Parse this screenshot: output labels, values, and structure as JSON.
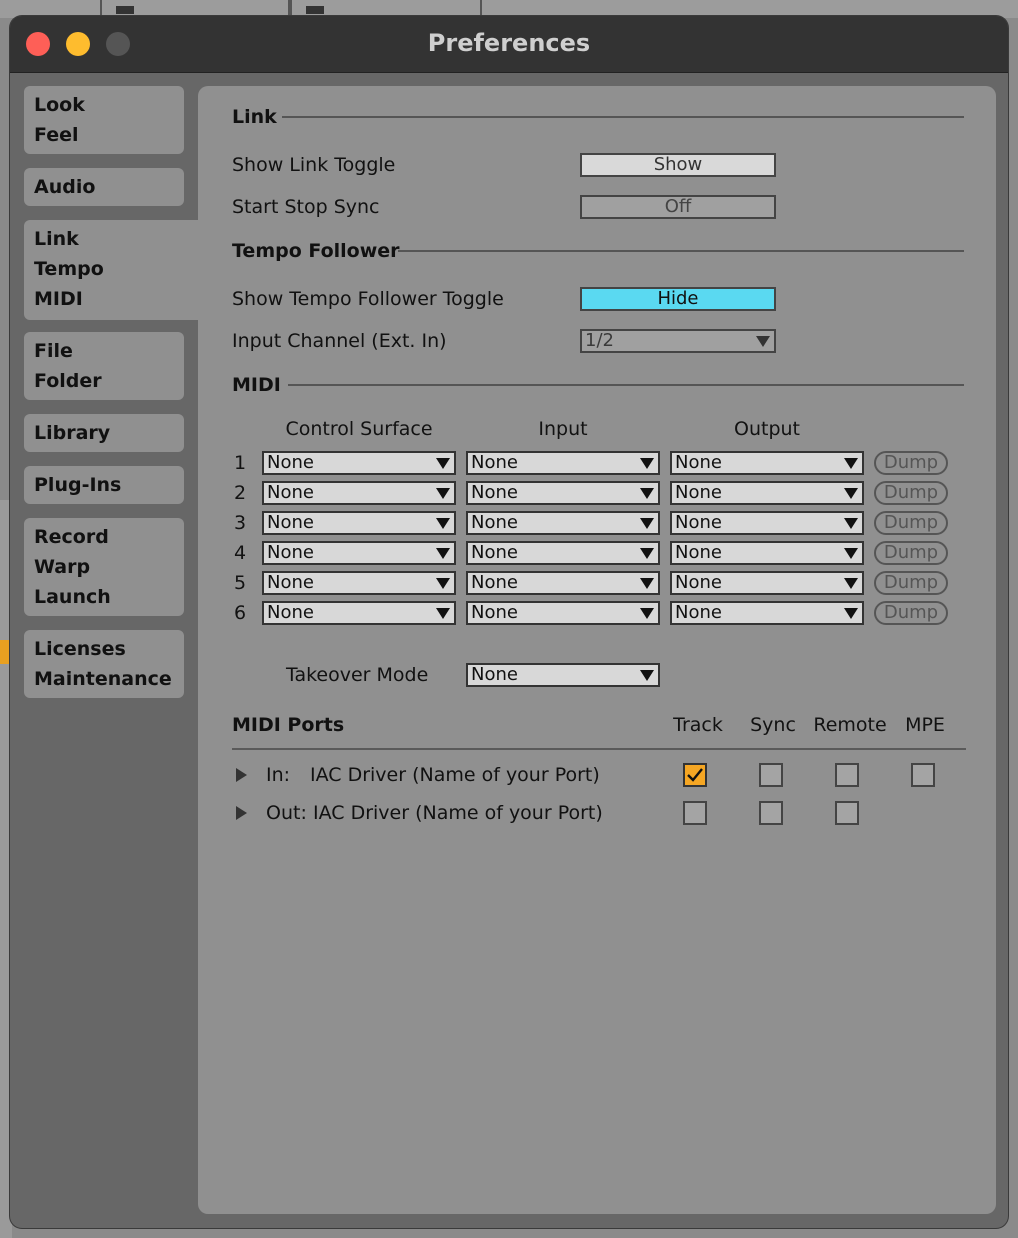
{
  "window": {
    "title": "Preferences"
  },
  "sidebar": {
    "groups": [
      {
        "items": [
          "Look",
          "Feel"
        ]
      },
      {
        "items": [
          "Audio"
        ]
      },
      {
        "items": [
          "Link",
          "Tempo",
          "MIDI"
        ]
      },
      {
        "items": [
          "File",
          "Folder"
        ]
      },
      {
        "items": [
          "Library"
        ]
      },
      {
        "items": [
          "Plug-Ins"
        ]
      },
      {
        "items": [
          "Record",
          "Warp",
          "Launch"
        ]
      },
      {
        "items": [
          "Licenses",
          "Maintenance"
        ]
      }
    ],
    "active_group": "Link Tempo MIDI"
  },
  "link": {
    "section_title": "Link",
    "show_link_toggle": {
      "label": "Show Link Toggle",
      "value": "Show"
    },
    "start_stop_sync": {
      "label": "Start Stop Sync",
      "value": "Off"
    }
  },
  "tempo_follower": {
    "section_title": "Tempo Follower",
    "show_toggle": {
      "label": "Show Tempo Follower Toggle",
      "value": "Hide"
    },
    "input_channel": {
      "label": "Input Channel (Ext. In)",
      "value": "1/2"
    }
  },
  "midi": {
    "section_title": "MIDI",
    "columns": {
      "control_surface": "Control Surface",
      "input": "Input",
      "output": "Output"
    },
    "rows": [
      {
        "num": "1",
        "control_surface": "None",
        "input": "None",
        "output": "None",
        "dump": "Dump"
      },
      {
        "num": "2",
        "control_surface": "None",
        "input": "None",
        "output": "None",
        "dump": "Dump"
      },
      {
        "num": "3",
        "control_surface": "None",
        "input": "None",
        "output": "None",
        "dump": "Dump"
      },
      {
        "num": "4",
        "control_surface": "None",
        "input": "None",
        "output": "None",
        "dump": "Dump"
      },
      {
        "num": "5",
        "control_surface": "None",
        "input": "None",
        "output": "None",
        "dump": "Dump"
      },
      {
        "num": "6",
        "control_surface": "None",
        "input": "None",
        "output": "None",
        "dump": "Dump"
      }
    ],
    "takeover_mode": {
      "label": "Takeover Mode",
      "value": "None"
    }
  },
  "midi_ports": {
    "title": "MIDI Ports",
    "columns": [
      "Track",
      "Sync",
      "Remote",
      "MPE"
    ],
    "ports": [
      {
        "direction": "In:",
        "name": "IAC Driver (Name of your Port)",
        "track": true,
        "sync": false,
        "remote": false,
        "mpe": false
      },
      {
        "direction": "Out:",
        "name": "IAC Driver (Name of your Port)",
        "track": false,
        "sync": false,
        "remote": false
      }
    ]
  },
  "colors": {
    "accent_hide": "#5ad9f1",
    "checkbox_on": "#f5a623"
  }
}
